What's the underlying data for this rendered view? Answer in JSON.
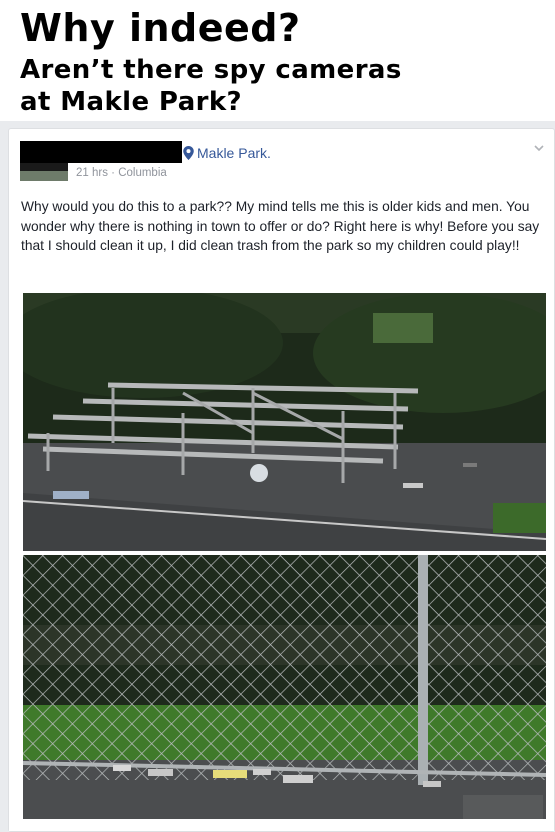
{
  "headline": {
    "title": "Why indeed?",
    "subtitle_line1": "Aren’t there spy cameras",
    "subtitle_line2": "at Makle Park?"
  },
  "post": {
    "location": "Makle Park.",
    "time": "21 hrs",
    "separator": " · ",
    "place": "Columbia",
    "text": "Why would you do this to a park?? My mind tells me this is older kids and men. You wonder why there is nothing in town to offer or do? Right here is why! Before you say that I should clean it up, I did clean trash from the park so my children could play!!"
  },
  "colors": {
    "link": "#365899",
    "meta": "#90949c",
    "text": "#1d2129",
    "frame": "#e9ebee"
  },
  "icons": {
    "location": "map-pin-icon",
    "menu": "chevron-down-icon"
  }
}
